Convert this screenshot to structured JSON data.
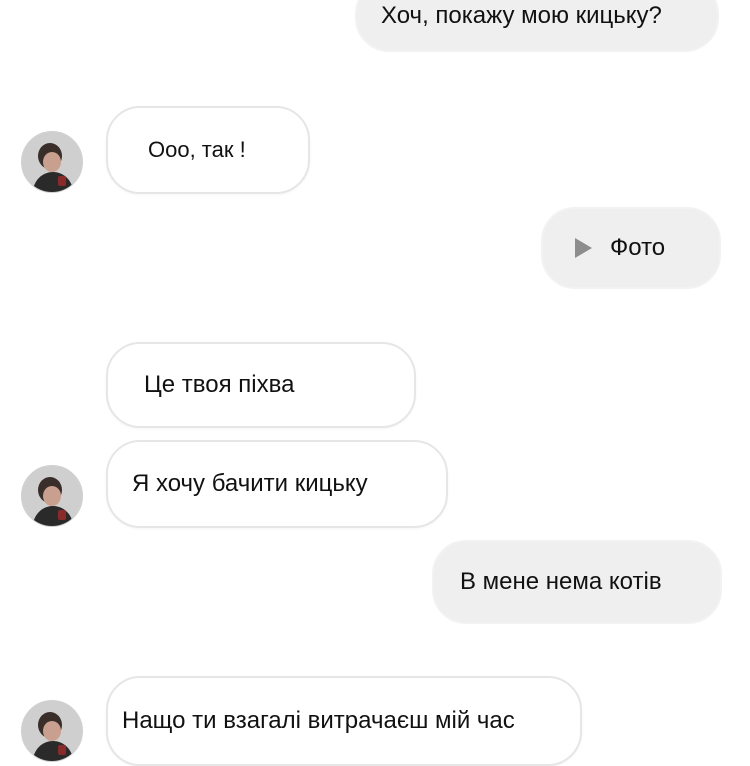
{
  "messages": [
    {
      "id": "m1",
      "direction": "outgoing",
      "text": "Хоч, покажу мою кицьку?"
    },
    {
      "id": "m2",
      "direction": "incoming",
      "text": "Ооо, так !"
    },
    {
      "id": "m3",
      "direction": "outgoing",
      "type": "media",
      "text": "Фото",
      "icon": "play-icon"
    },
    {
      "id": "m4",
      "direction": "incoming",
      "text": "Це твоя піхва"
    },
    {
      "id": "m5",
      "direction": "incoming",
      "text": "Я хочу бачити кицьку"
    },
    {
      "id": "m6",
      "direction": "outgoing",
      "text": "В мене нема котів"
    },
    {
      "id": "m7",
      "direction": "incoming",
      "text": "Нащо ти взагалі витрачаєш мій час"
    }
  ],
  "colors": {
    "incoming_bubble_bg": "#ffffff",
    "incoming_bubble_border": "#e6e6e6",
    "outgoing_bubble_bg": "#efefef",
    "text": "#111111",
    "play_icon": "#8d8d8d"
  }
}
